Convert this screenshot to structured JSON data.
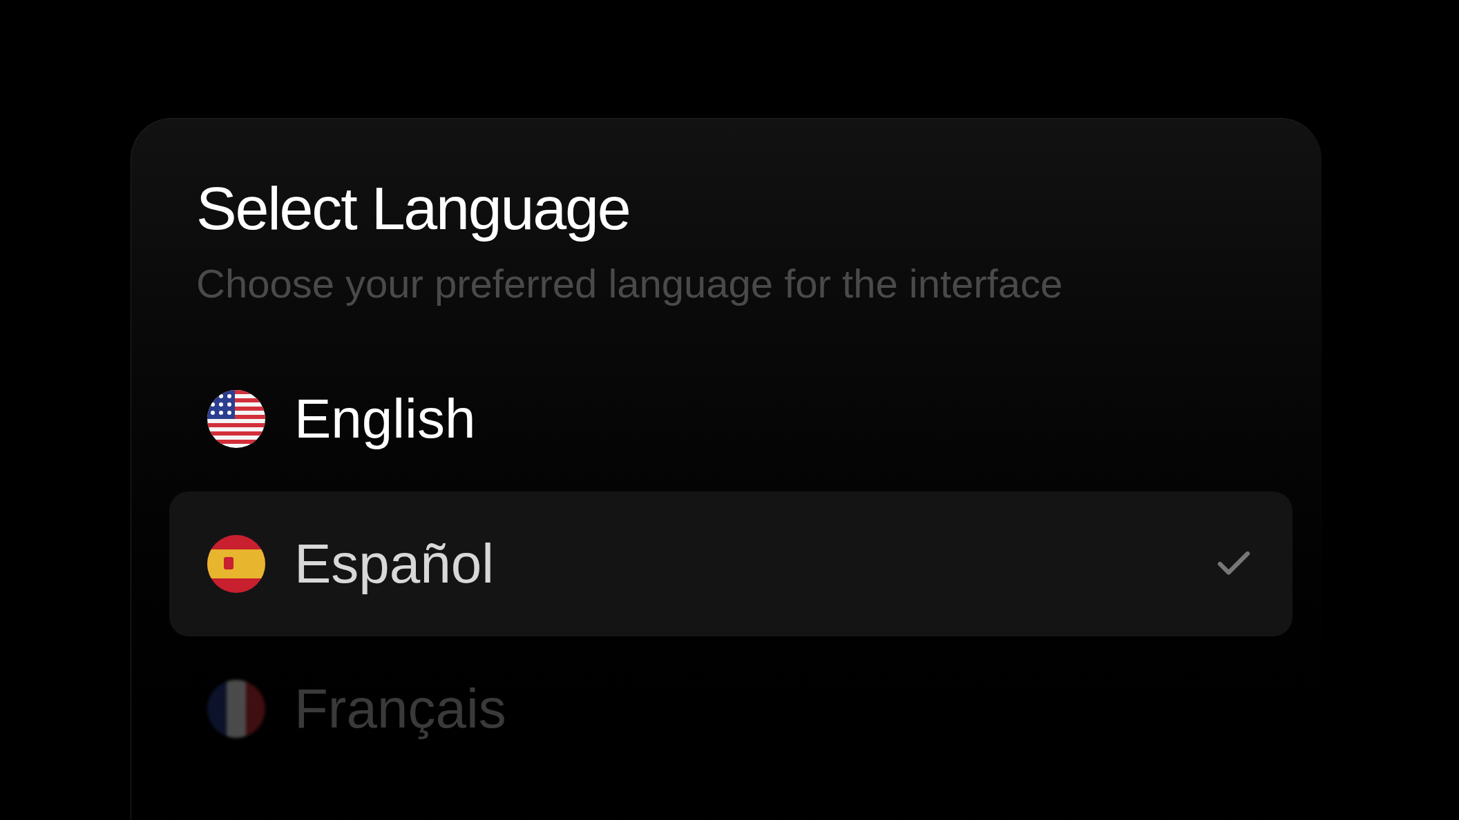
{
  "title": "Select Language",
  "subtitle": "Choose your preferred language for the interface",
  "languages": [
    {
      "label": "English",
      "kind": "us",
      "selected": false
    },
    {
      "label": "Español",
      "kind": "es",
      "selected": true
    },
    {
      "label": "Français",
      "kind": "fr",
      "selected": false
    }
  ]
}
